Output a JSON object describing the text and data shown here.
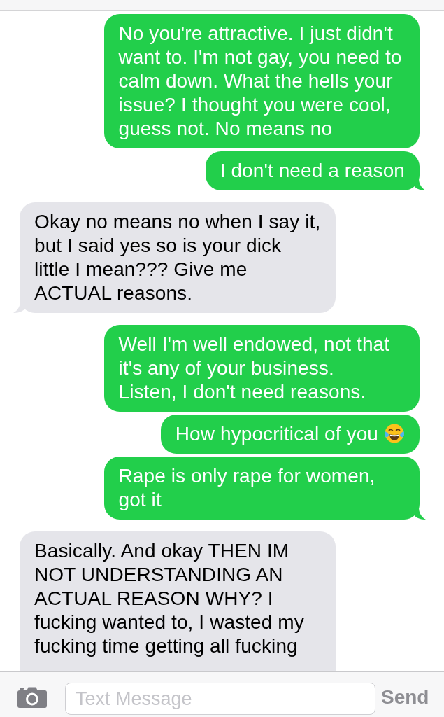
{
  "messages": [
    {
      "kind": "sent",
      "text": "No you're attractive. I just didn't want to. I'm not gay, you need to calm down. What the hells your issue? I thought you were cool, guess not. No means no",
      "tail": false,
      "has_emoji": false,
      "cut_off": false
    },
    {
      "kind": "sent",
      "text": "I don't need a reason",
      "tail": true,
      "has_emoji": false,
      "cut_off": false
    },
    {
      "kind": "received",
      "text": "Okay no means no when I say it, but I said yes so is your dick little I mean??? Give me ACTUAL reasons.",
      "tail": true,
      "has_emoji": false,
      "cut_off": false
    },
    {
      "kind": "sent",
      "text": "Well I'm well endowed, not that it's any of your business.\nListen, I don't need reasons.",
      "tail": false,
      "has_emoji": false,
      "cut_off": false
    },
    {
      "kind": "sent",
      "text": "How hypocritical of you",
      "tail": false,
      "has_emoji": true,
      "cut_off": false
    },
    {
      "kind": "sent",
      "text": "Rape is only rape for women, got it",
      "tail": true,
      "has_emoji": false,
      "cut_off": false
    },
    {
      "kind": "received",
      "text": "Basically. And okay THEN IM NOT UNDERSTANDING AN ACTUAL REASON WHY? I fucking wanted to, I wasted my fucking time getting all fucking",
      "tail": false,
      "has_emoji": false,
      "cut_off": true
    }
  ],
  "composer": {
    "placeholder": "Text Message",
    "send_label": "Send"
  }
}
